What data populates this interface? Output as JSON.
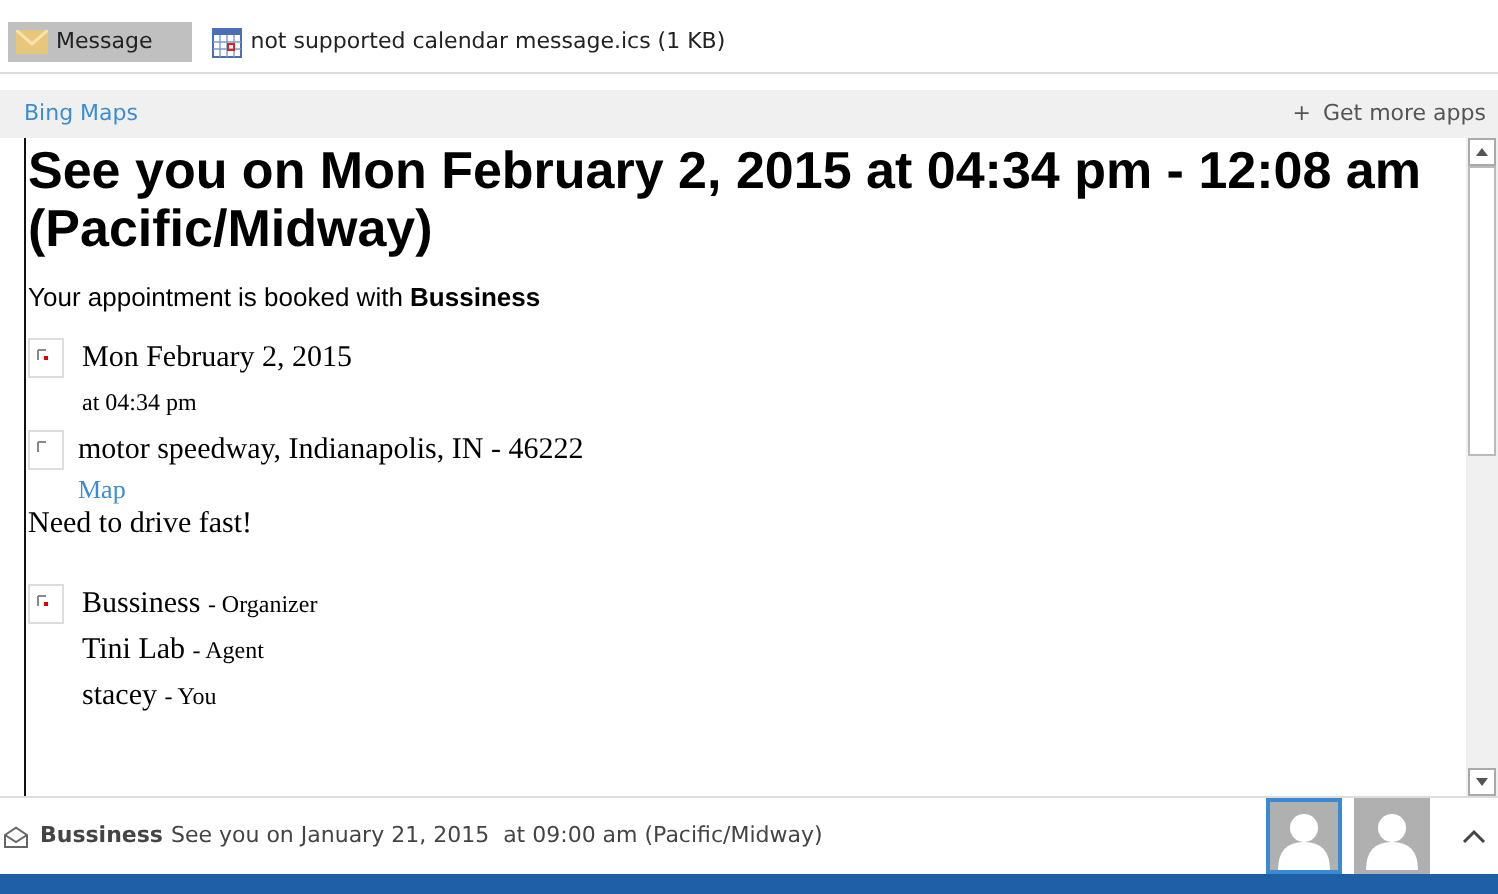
{
  "attachments": [
    {
      "label": "Message",
      "kind": "message",
      "selected": true
    },
    {
      "label": "not supported calendar message.ics (1 KB)",
      "kind": "calendar",
      "selected": false
    }
  ],
  "apps_bar": {
    "app": "Bing Maps",
    "get_more_icon": "+",
    "get_more": "Get more apps"
  },
  "message": {
    "heading": "See you on Mon February 2, 2015 at 04:34 pm - 12:08 am (Pacific/Midway)",
    "intro": "Your appointment is booked with **Bussiness**",
    "date": {
      "main": "Mon February 2, 2015",
      "sub": "at 04:34 pm"
    },
    "location": {
      "main": "motor speedway, Indianapolis, IN - 46222",
      "link": "Map"
    },
    "note": "Need to drive fast!",
    "people": [
      {
        "name": "Bussiness",
        "role": "- Organizer"
      },
      {
        "name": "Tini Lab",
        "role": "- Agent"
      },
      {
        "name": "stacey",
        "role": "- You"
      }
    ]
  },
  "footer": {
    "sender": "Bussiness",
    "subject": "See you on January 21, 2015  at 09:00 am (Pacific/Midway)",
    "avatars": [
      {
        "selected": true
      },
      {
        "selected": false
      }
    ]
  }
}
